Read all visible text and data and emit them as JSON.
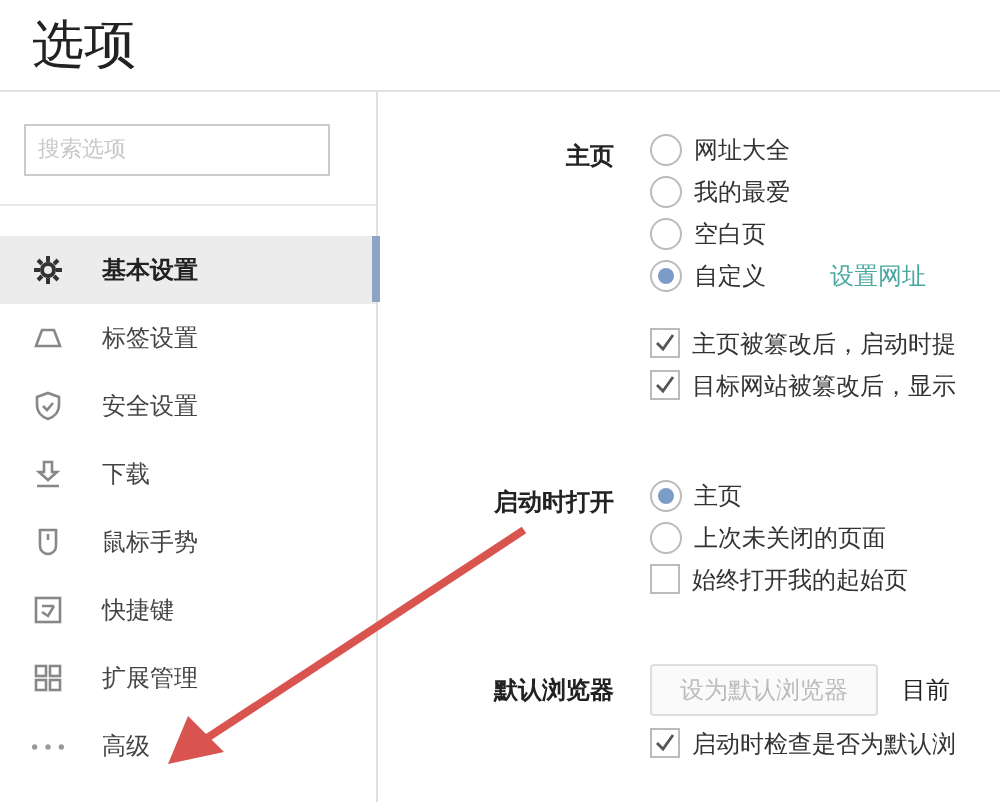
{
  "window": {
    "title": "选项"
  },
  "search": {
    "placeholder": "搜索选项"
  },
  "sidebar": {
    "items": [
      {
        "label": "基本设置",
        "selected": true
      },
      {
        "label": "标签设置",
        "selected": false
      },
      {
        "label": "安全设置",
        "selected": false
      },
      {
        "label": "下载",
        "selected": false
      },
      {
        "label": "鼠标手势",
        "selected": false
      },
      {
        "label": "快捷键",
        "selected": false
      },
      {
        "label": "扩展管理",
        "selected": false
      },
      {
        "label": "高级",
        "selected": false
      }
    ]
  },
  "sections": [
    {
      "label": "主页",
      "items": [
        {
          "kind": "radio",
          "label": "网址大全",
          "selected": false
        },
        {
          "kind": "radio",
          "label": "我的最爱",
          "selected": false
        },
        {
          "kind": "radio",
          "label": "空白页",
          "selected": false
        },
        {
          "kind": "radio",
          "label": "自定义",
          "selected": true,
          "link": "设置网址"
        },
        {
          "kind": "gap"
        },
        {
          "kind": "checkbox",
          "label": "主页被篡改后，启动时提",
          "checked": true
        },
        {
          "kind": "checkbox",
          "label": "目标网站被篡改后，显示",
          "checked": true
        }
      ]
    },
    {
      "label": "启动时打开",
      "items": [
        {
          "kind": "radio",
          "label": "主页",
          "selected": true
        },
        {
          "kind": "radio",
          "label": "上次未关闭的页面",
          "selected": false
        },
        {
          "kind": "checkbox",
          "label": "始终打开我的起始页",
          "checked": false
        }
      ]
    },
    {
      "label": "默认浏览器",
      "items": [
        {
          "kind": "button",
          "label": "设为默认浏览器",
          "disabled": true,
          "note": "目前"
        },
        {
          "kind": "checkbox",
          "label": "启动时检查是否为默认浏",
          "checked": true
        }
      ]
    }
  ]
}
